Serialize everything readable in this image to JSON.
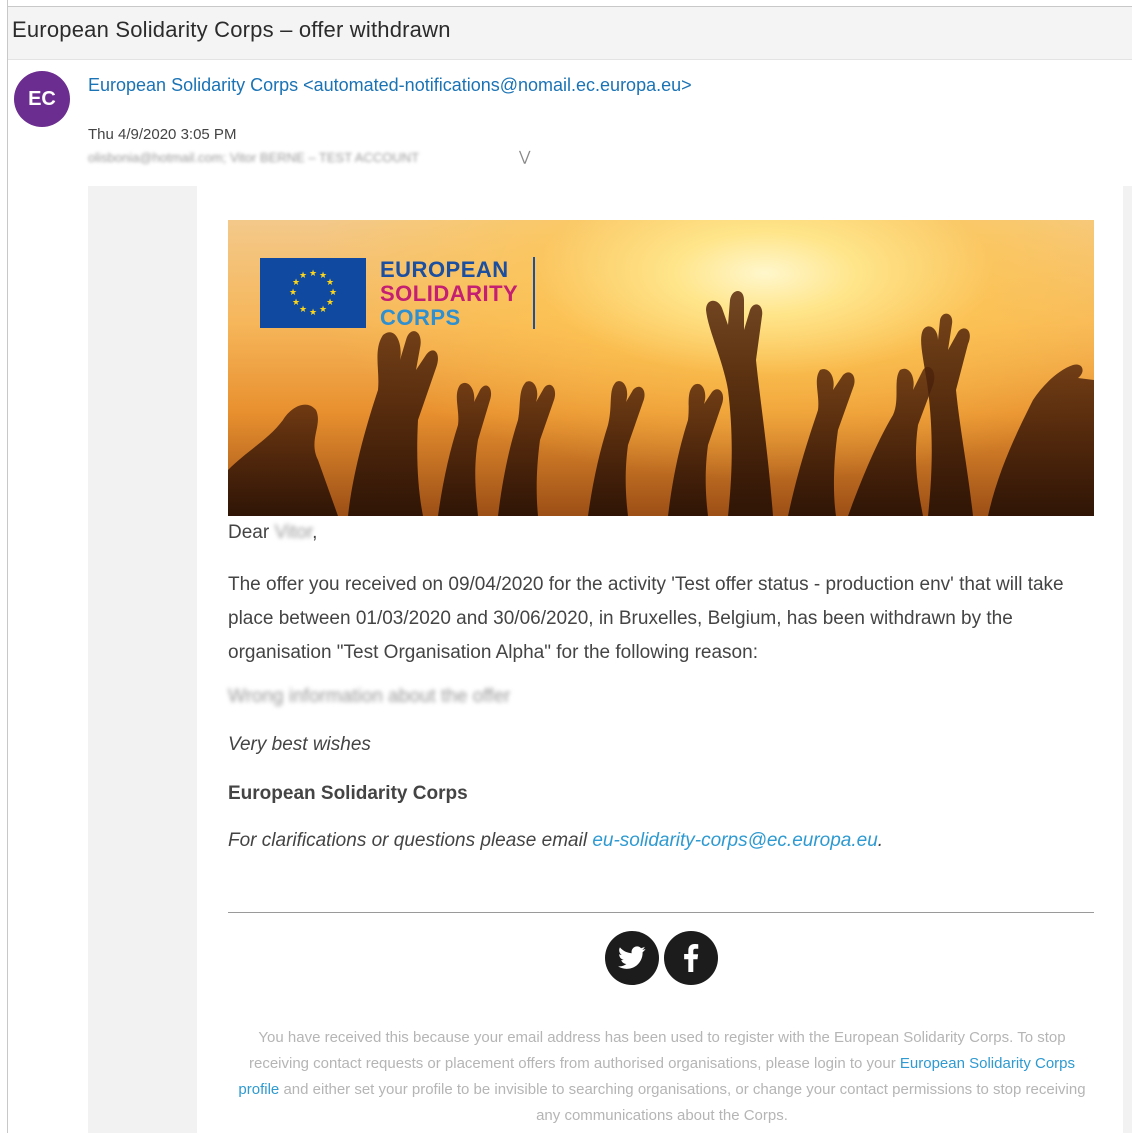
{
  "subject": "European Solidarity Corps – offer withdrawn",
  "sender": {
    "initials": "EC",
    "display": "European Solidarity Corps <automated-notifications@nomail.ec.europa.eu>",
    "date": "Thu 4/9/2020 3:05 PM",
    "recipients": "olisbonia@hotmail.com; Vitor BERNE – TEST ACCOUNT"
  },
  "banner": {
    "logo_line1": "EUROPEAN",
    "logo_line2": "SOLIDARITY",
    "logo_line3": "CORPS"
  },
  "email": {
    "dear_label": "Dear",
    "dear_name": "Vitor",
    "dear_punct": ",",
    "paragraph": "The offer you received on 09/04/2020 for the activity 'Test offer status - production env' that will take place between 01/03/2020 and 30/06/2020, in Bruxelles, Belgium, has been withdrawn by the organisation \"Test Organisation Alpha\" for the following reason:",
    "reason": "Wrong information about the offer",
    "wishes": "Very best wishes",
    "signature": "European Solidarity Corps",
    "clarif_text": "For clarifications or questions please email ",
    "clarif_email": "eu-solidarity-corps@ec.europa.eu",
    "clarif_end": "."
  },
  "social": {
    "twitter_icon": "twitter-icon",
    "facebook_icon": "facebook-icon"
  },
  "footer": {
    "text_before": "You have received this because your email address has been used to register with the European Solidarity Corps. To stop receiving contact requests or placement offers from authorised organisations, please login to your ",
    "link": "European Solidarity Corps profile",
    "text_after": " and either set your profile to be invisible to searching organisations, or change your contact permissions to stop receiving any communications about the Corps."
  },
  "colors": {
    "avatar": "#6b2d8f",
    "link": "#1a73b5",
    "accent_link": "#2e9ad1",
    "logo_blue": "#1c4fa0",
    "logo_magenta": "#c41f72"
  }
}
